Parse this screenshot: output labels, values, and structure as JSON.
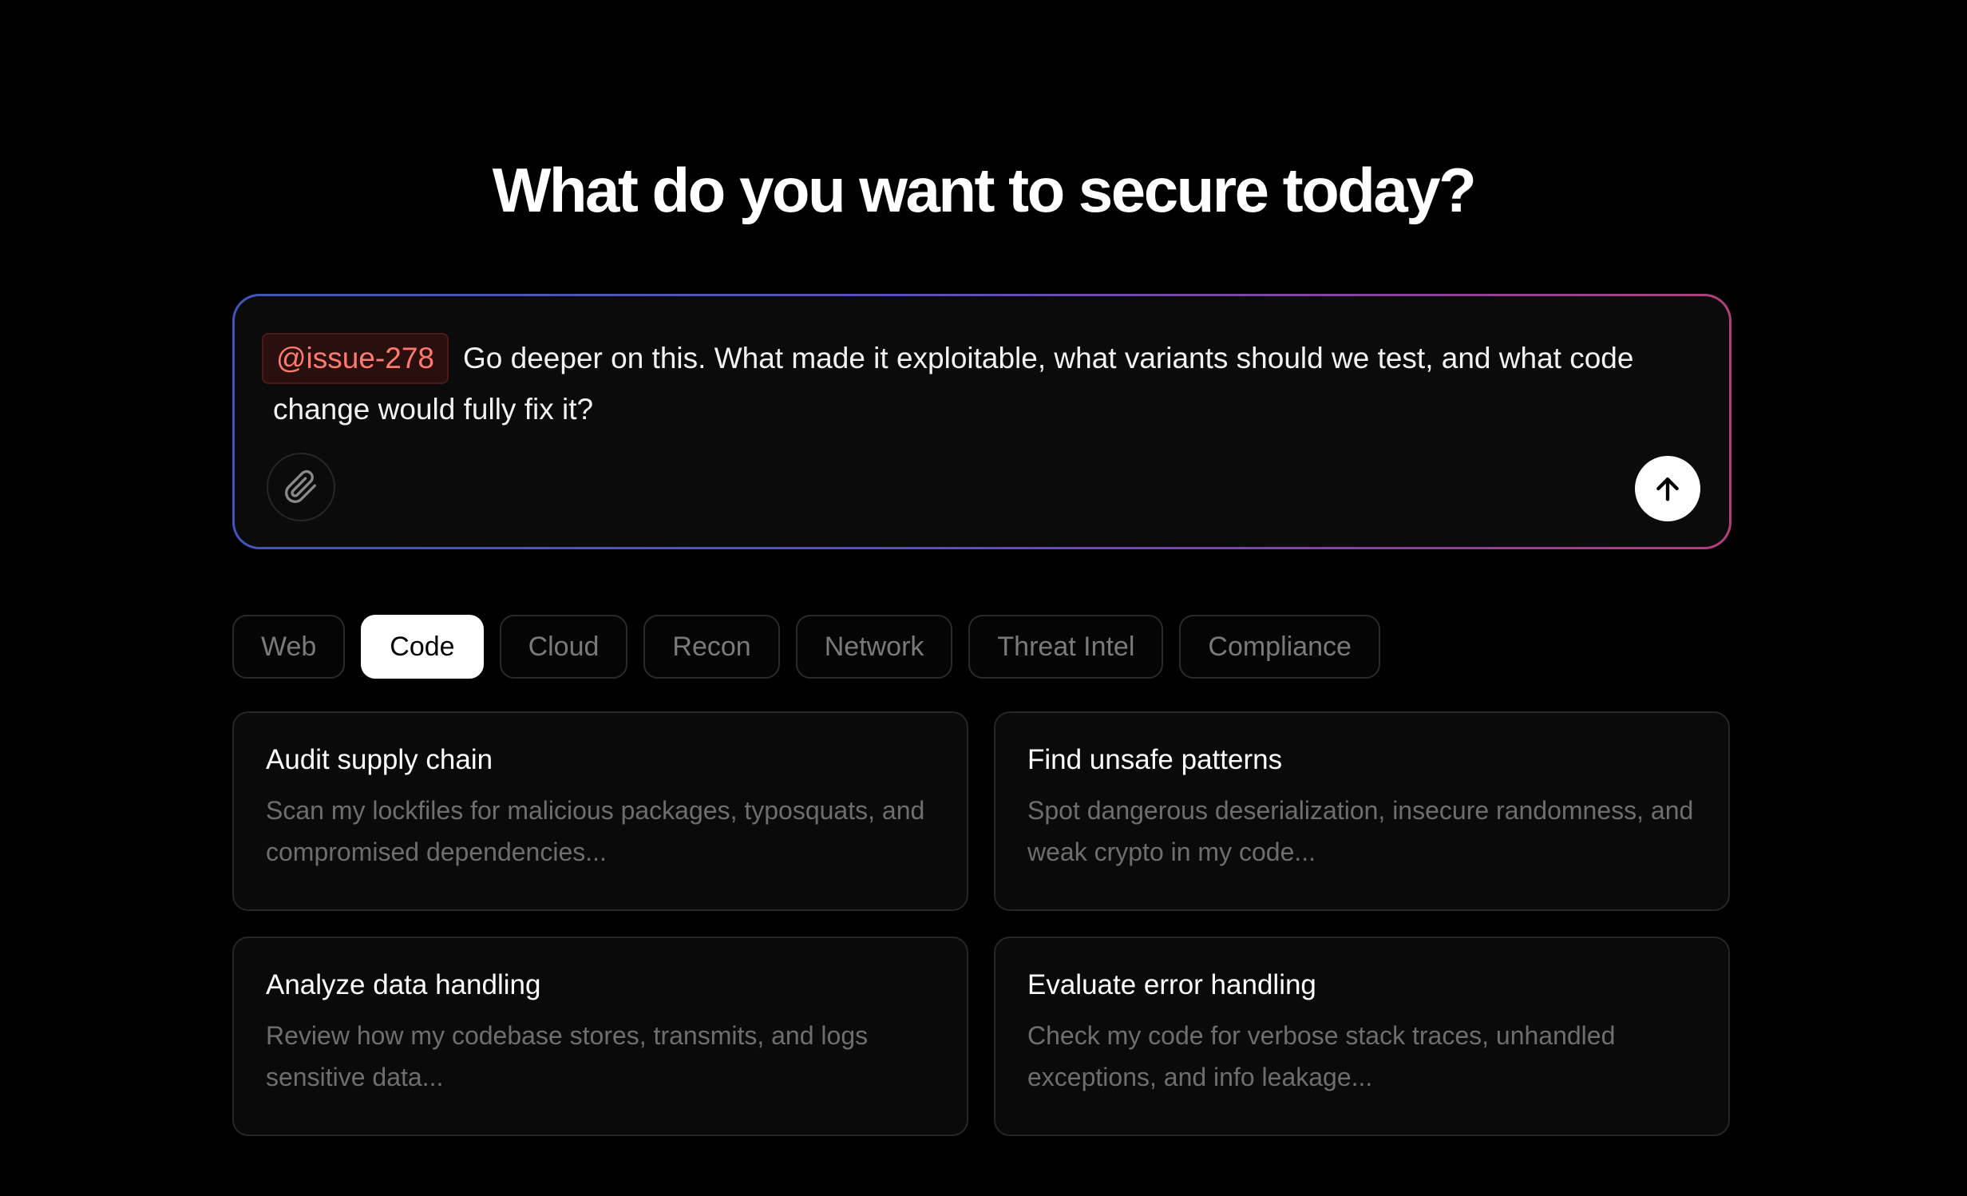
{
  "header": {
    "title": "What do you want to secure today?"
  },
  "prompt": {
    "mention": "@issue-278",
    "text": "Go deeper on this. What made it exploitable, what variants should we test, and what code change would fully fix it?",
    "attach_icon": "paperclip-icon",
    "send_icon": "arrow-up-icon"
  },
  "tabs": [
    {
      "label": "Web",
      "active": false
    },
    {
      "label": "Code",
      "active": true
    },
    {
      "label": "Cloud",
      "active": false
    },
    {
      "label": "Recon",
      "active": false
    },
    {
      "label": "Network",
      "active": false
    },
    {
      "label": "Threat Intel",
      "active": false
    },
    {
      "label": "Compliance",
      "active": false
    }
  ],
  "cards": [
    {
      "title": "Audit supply chain",
      "description": "Scan my lockfiles for malicious packages, typosquats, and compromised dependencies..."
    },
    {
      "title": "Find unsafe patterns",
      "description": "Spot dangerous deserialization, insecure randomness, and weak crypto in my code..."
    },
    {
      "title": "Analyze data handling",
      "description": "Review how my codebase stores, transmits, and logs sensitive data..."
    },
    {
      "title": "Evaluate error handling",
      "description": "Check my code for verbose stack traces, unhandled exceptions, and info leakage..."
    }
  ],
  "colors": {
    "background": "#000000",
    "mention_text": "#ff7a6e",
    "gradient_start": "#3f56b8",
    "gradient_end": "#b23f7a"
  }
}
